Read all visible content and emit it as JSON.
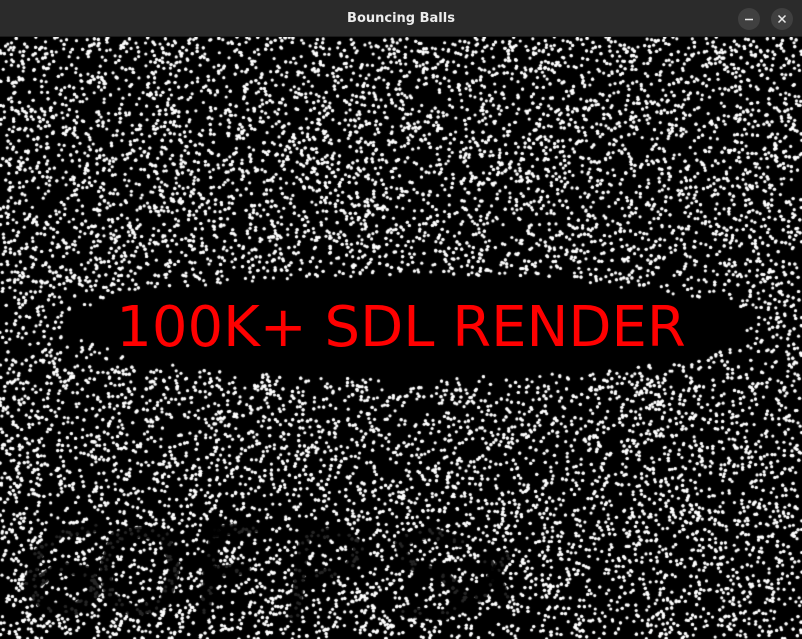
{
  "window": {
    "title": "Bouncing Balls",
    "minimize_icon": "minimize-icon",
    "close_icon": "close-icon"
  },
  "scene": {
    "banner_text": "100K+ SDL RENDER",
    "banner_color": "#ff0000",
    "background_color": "#000000",
    "ball_color": "#ffffff",
    "handwritten_text": "60FPS"
  }
}
